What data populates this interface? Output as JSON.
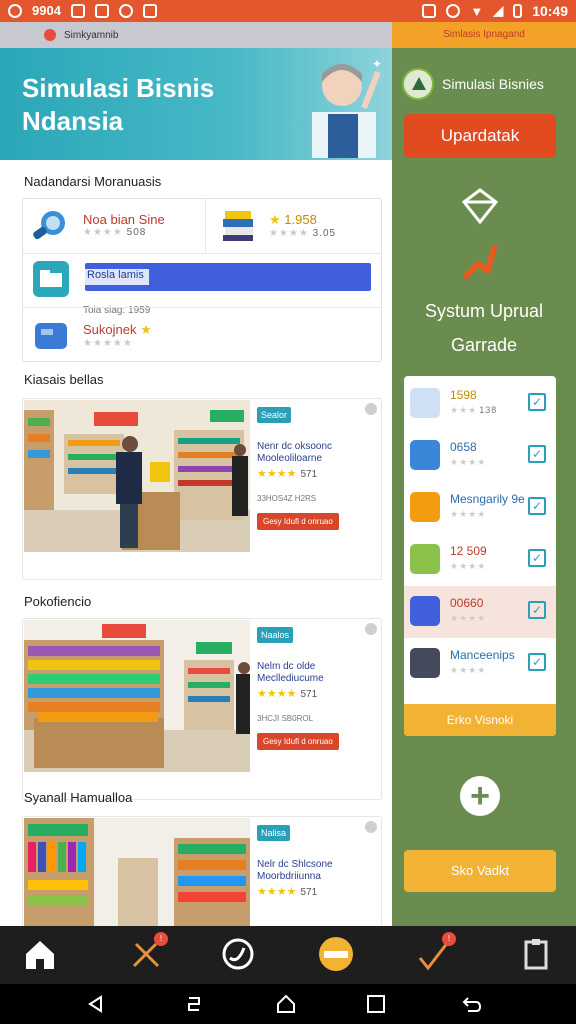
{
  "status_bar": {
    "left_text": "9904",
    "time": "10:49"
  },
  "left": {
    "strip_text": "Simkyamnib",
    "hero_title_line1": "Simulasi Bisnis",
    "hero_title_line2": "Ndansia",
    "section1_title": "Nadandarsi Moranuasis",
    "products": [
      {
        "name": "Noa bian Sine",
        "meta": "508"
      },
      {
        "name": "1.958",
        "meta": "3.05"
      },
      {
        "name": "Rosla lamis",
        "meta": "Toia siag: 1959"
      },
      {
        "name": "Sukojnek",
        "meta": ""
      }
    ],
    "section2_title": "Kiasais bellas",
    "section3_title": "Pokofiencio",
    "section4_title": "Syanall Hamualloa",
    "features": [
      {
        "badge": "Sealor",
        "line1": "Nenr dc oksoonc",
        "line2": "Mooleoliloarne",
        "rating": "571",
        "small": "33HOS4Z H2RS",
        "button": "Gesy Idufl d onruao"
      },
      {
        "badge": "Naalos",
        "line1": "Nelm dc olde",
        "line2": "Mecllediucume",
        "rating": "571",
        "small": "3HCJI SB0ROL",
        "button": "Gesy Idufl d onruao"
      },
      {
        "badge": "Nalisa",
        "line1": "Nelr dc Shlcsone",
        "line2": "Moorbdriiunna",
        "rating": "571",
        "small": "",
        "button": ""
      }
    ]
  },
  "right": {
    "strip_text": "Simlasis Ipnagand",
    "header_title": "Simulasi Bisnies",
    "update_button": "Upardatak",
    "system_line1": "Systum Uprual",
    "system_line2": "Garrade",
    "items": [
      {
        "value": "1598",
        "meta": "138"
      },
      {
        "value": "0658",
        "meta": ""
      },
      {
        "value": "Mesngarily 9e",
        "meta": ""
      },
      {
        "value": "12 509",
        "meta": ""
      },
      {
        "value": "00660",
        "meta": ""
      },
      {
        "value": "Manceenips",
        "meta": ""
      }
    ],
    "list_footer": "Erko Visnoki",
    "bottom_button": "Sko Vadkt"
  },
  "colors": {
    "accent_orange": "#e24a1f",
    "panel_green": "#6a8c4e",
    "teal": "#2aa7b8",
    "gold": "#f2b233"
  }
}
